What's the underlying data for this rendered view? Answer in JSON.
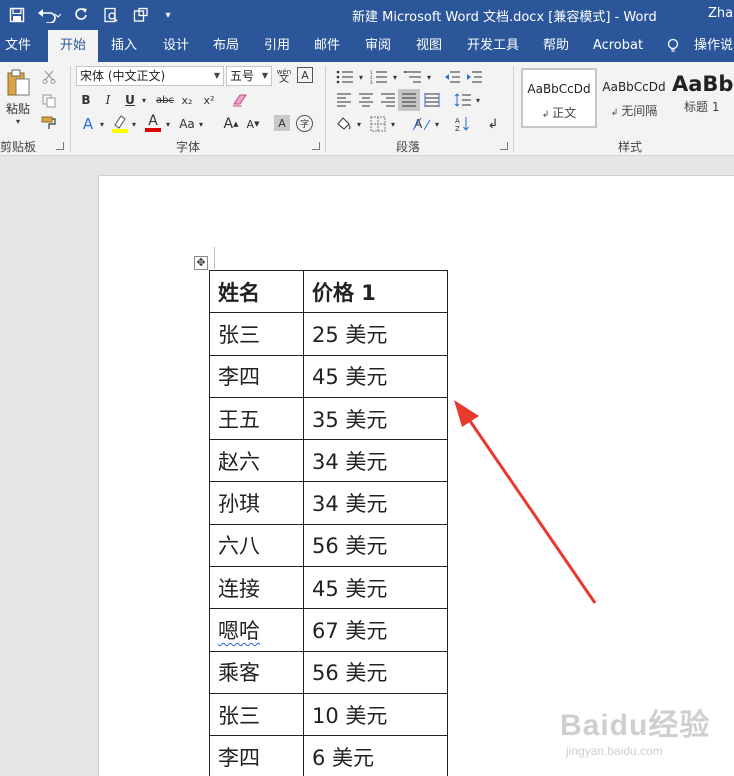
{
  "titlebar": {
    "title": "新建 Microsoft Word 文档.docx [兼容模式]  -  Word",
    "user": "Zhan"
  },
  "tabs": [
    "文件",
    "开始",
    "插入",
    "设计",
    "布局",
    "引用",
    "邮件",
    "审阅",
    "视图",
    "开发工具",
    "帮助",
    "Acrobat",
    "操作说明"
  ],
  "active_tab": "开始",
  "ribbon": {
    "clipboard": {
      "paste_label": "粘贴",
      "group_label": "剪贴板"
    },
    "font": {
      "font_name": "宋体 (中文正文)",
      "font_size": "五号",
      "bold": "B",
      "italic": "I",
      "underline": "U",
      "strike": "abc",
      "subscript": "x₂",
      "superscript": "x²",
      "case": "Aa",
      "grow": "A",
      "shrink": "A",
      "group_label": "字体",
      "phonetic": "wén\n文"
    },
    "paragraph": {
      "group_label": "段落"
    },
    "styles": {
      "items": [
        {
          "sample": "AaBbCcDd",
          "name": "正文"
        },
        {
          "sample": "AaBbCcDd",
          "name": "无间隔"
        },
        {
          "sample": "AaBb",
          "name": "标题 1"
        }
      ],
      "group_label": "样式"
    }
  },
  "table": {
    "header": [
      "姓名",
      "价格 1"
    ],
    "rows": [
      [
        "张三",
        "25 美元"
      ],
      [
        "李四",
        "45 美元"
      ],
      [
        "王五",
        "35 美元"
      ],
      [
        "赵六",
        "34 美元"
      ],
      [
        "孙琪",
        "34 美元"
      ],
      [
        "六八",
        "56 美元"
      ],
      [
        "连接",
        "45 美元"
      ],
      [
        "嗯哈",
        "67 美元"
      ],
      [
        "乘客",
        "56 美元"
      ],
      [
        "张三",
        "10 美元"
      ],
      [
        "李四",
        "6 美元"
      ]
    ]
  },
  "colors": {
    "ribbon_blue": "#2b579a",
    "arrow_red": "#e8392f",
    "highlight_yellow": "#ffff00",
    "font_color_red": "#e00000"
  },
  "watermark": {
    "brand": "Baidu经验",
    "url": "jingyan.baidu.com"
  }
}
